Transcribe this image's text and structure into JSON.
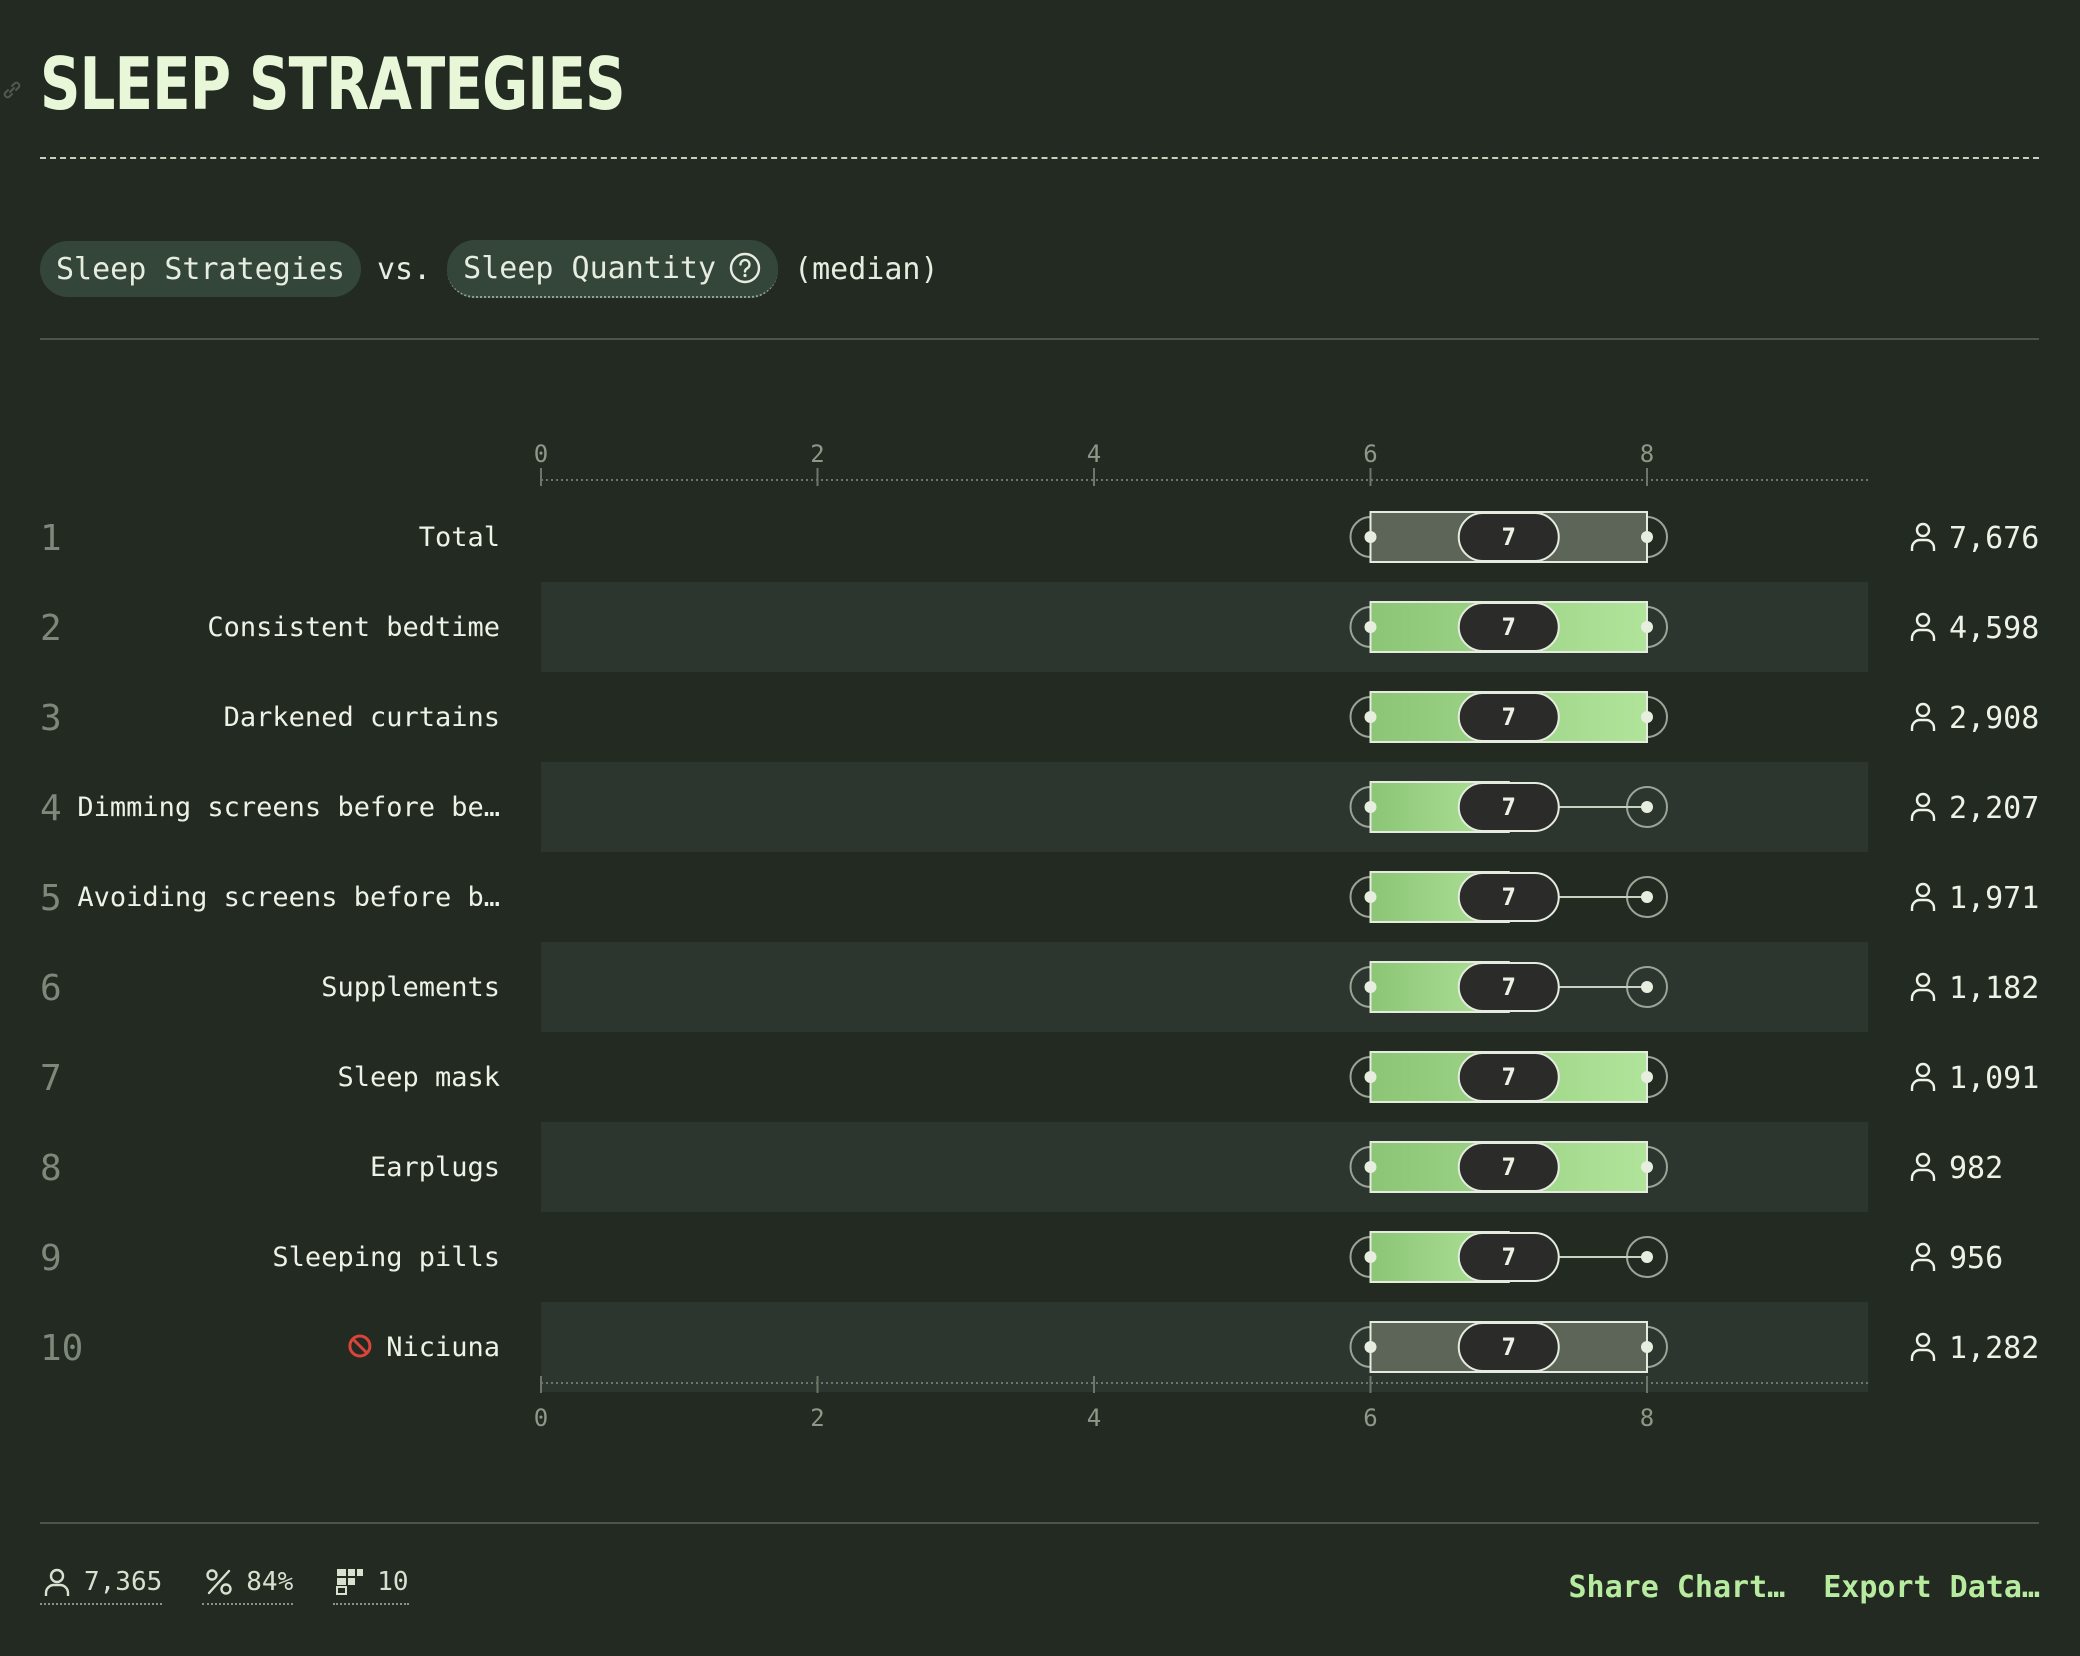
{
  "page": {
    "title": "SLEEP STRATEGIES"
  },
  "query": {
    "primary": "Sleep Strategies",
    "separator": "vs.",
    "secondary": "Sleep Quantity",
    "suffix": "(median)"
  },
  "chart_data": {
    "type": "boxplot",
    "x_ticks": [
      0,
      2,
      4,
      6,
      8
    ],
    "xlim": [
      0,
      9.6
    ],
    "rows": [
      {
        "rank": "1",
        "label": "Total",
        "q1": 6,
        "median": 7,
        "q3": 8,
        "min": 6,
        "max": 8,
        "count": "7,676",
        "style": "total"
      },
      {
        "rank": "2",
        "label": "Consistent bedtime",
        "q1": 6,
        "median": 7,
        "q3": 8,
        "min": 6,
        "max": 8,
        "count": "4,598",
        "style": "full"
      },
      {
        "rank": "3",
        "label": "Darkened curtains",
        "q1": 6,
        "median": 7,
        "q3": 8,
        "min": 6,
        "max": 8,
        "count": "2,908",
        "style": "full"
      },
      {
        "rank": "4",
        "label": "Dimming screens before be…",
        "q1": 6,
        "median": 7,
        "q3": 7,
        "min": 6,
        "max": 8,
        "count": "2,207",
        "style": "half"
      },
      {
        "rank": "5",
        "label": "Avoiding screens before b…",
        "q1": 6,
        "median": 7,
        "q3": 7,
        "min": 6,
        "max": 8,
        "count": "1,971",
        "style": "half"
      },
      {
        "rank": "6",
        "label": "Supplements",
        "q1": 6,
        "median": 7,
        "q3": 7,
        "min": 6,
        "max": 8,
        "count": "1,182",
        "style": "half"
      },
      {
        "rank": "7",
        "label": "Sleep mask",
        "q1": 6,
        "median": 7,
        "q3": 8,
        "min": 6,
        "max": 8,
        "count": "1,091",
        "style": "full"
      },
      {
        "rank": "8",
        "label": "Earplugs",
        "q1": 6,
        "median": 7,
        "q3": 8,
        "min": 6,
        "max": 8,
        "count": "982",
        "style": "full"
      },
      {
        "rank": "9",
        "label": "Sleeping pills",
        "q1": 6,
        "median": 7,
        "q3": 7,
        "min": 6,
        "max": 8,
        "count": "956",
        "style": "half"
      },
      {
        "rank": "10",
        "label": "Niciuna",
        "prefix_icon": "no-entry-icon",
        "q1": 6,
        "median": 7,
        "q3": 8,
        "min": 6,
        "max": 8,
        "count": "1,282",
        "style": "total"
      }
    ]
  },
  "footer": {
    "respondents": "7,365",
    "percent": "84%",
    "groups": "10",
    "share_label": "Share Chart…",
    "export_label": "Export Data…"
  },
  "colors": {
    "background": "#232a22",
    "stripe": "#2c352e",
    "accent": "#b6eba0",
    "bar_green_dark": "#8cc576",
    "bar_green_light": "#b0e49a",
    "total_box": "#5c6558",
    "median_pill": "#2b2c2a"
  },
  "icons": {
    "respondents": "person-icon",
    "percent": "percent-icon",
    "groups": "groups-icon",
    "help": "question-circle-icon",
    "anchor": "link-icon"
  }
}
